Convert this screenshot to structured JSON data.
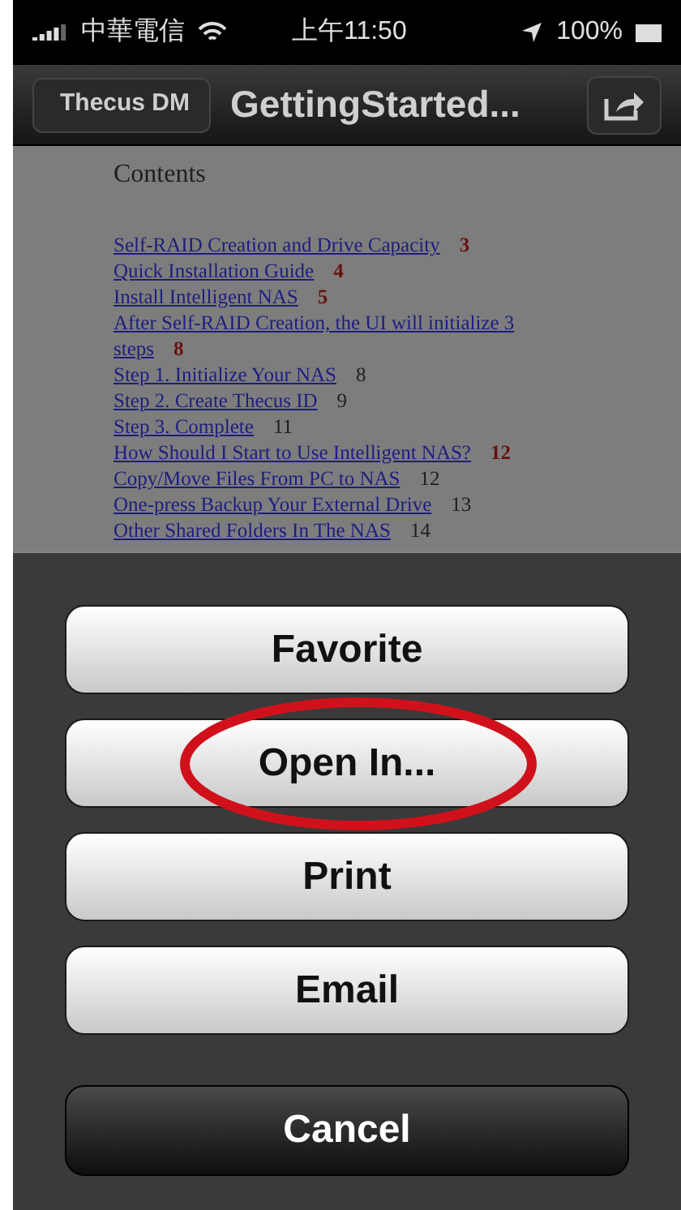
{
  "status_bar": {
    "carrier": "中華電信",
    "time": "上午11:50",
    "battery": "100%"
  },
  "nav_bar": {
    "back": "Thecus DM",
    "title": "GettingStarted..."
  },
  "document": {
    "heading": "Contents",
    "toc": [
      {
        "title": "Self-RAID Creation and Drive Capacity",
        "page": "3",
        "kind": "chapter"
      },
      {
        "title": "Quick Installation Guide",
        "page": "4",
        "kind": "chapter"
      },
      {
        "title": "Install Intelligent NAS",
        "page": "5",
        "kind": "chapter"
      },
      {
        "title": "After Self-RAID Creation, the UI will initialize 3 steps",
        "page": "8",
        "kind": "chapter"
      },
      {
        "title": "Step 1. Initialize Your NAS",
        "page": "8",
        "kind": "section"
      },
      {
        "title": "Step 2. Create Thecus ID",
        "page": "9",
        "kind": "section"
      },
      {
        "title": "Step 3. Complete",
        "page": "11",
        "kind": "section"
      },
      {
        "title": "How Should I Start to Use Intelligent NAS?",
        "page": "12",
        "kind": "chapter"
      },
      {
        "title": "Copy/Move Files From PC to NAS",
        "page": "12",
        "kind": "section"
      },
      {
        "title": "One-press Backup Your External Drive",
        "page": "13",
        "kind": "section"
      },
      {
        "title": "Other Shared Folders In The NAS",
        "page": "14",
        "kind": "section"
      }
    ]
  },
  "action_sheet": {
    "buttons": [
      {
        "label": "Favorite",
        "kind": "default",
        "circled": false
      },
      {
        "label": "Open In...",
        "kind": "default",
        "circled": true
      },
      {
        "label": "Print",
        "kind": "default",
        "circled": false
      },
      {
        "label": "Email",
        "kind": "default",
        "circled": false
      },
      {
        "label": "Cancel",
        "kind": "cancel",
        "circled": false
      }
    ]
  }
}
